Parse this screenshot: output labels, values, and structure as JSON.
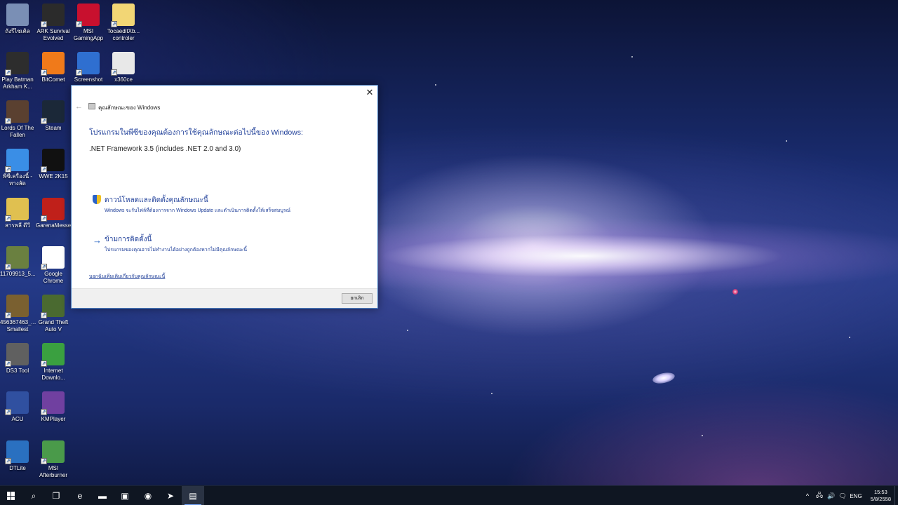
{
  "desktop": {
    "icons": [
      {
        "label": "ถังรีไซเคิล",
        "icon": "recycle-bin-icon"
      },
      {
        "label": "ARK Survival Evolved",
        "icon": "ark-game-icon"
      },
      {
        "label": "MSI GamingApp",
        "icon": "msi-gaming-app-icon"
      },
      {
        "label": "TocaeditXb... controler",
        "icon": "folder-icon"
      },
      {
        "label": "Play Batman Arkham K...",
        "icon": "batman-game-icon"
      },
      {
        "label": "BitComet",
        "icon": "bitcomet-icon"
      },
      {
        "label": "Screenshot",
        "icon": "screenshot-icon"
      },
      {
        "label": "x360ce",
        "icon": "x360ce-icon"
      },
      {
        "label": "Lords Of The Fallen",
        "icon": "lords-of-the-fallen-icon"
      },
      {
        "label": "Steam",
        "icon": "steam-icon"
      },
      {
        "label": "พีซีเครื่องนี้ - ทางลัด",
        "icon": "this-pc-icon"
      },
      {
        "label": "WWE 2K15",
        "icon": "wwe-2k15-icon"
      },
      {
        "label": "สารพลี ดีวี",
        "icon": "shortcut-file-icon"
      },
      {
        "label": "GarenaMesse",
        "icon": "garena-messenger-icon"
      },
      {
        "label": "11709913_5...",
        "icon": "image-file-icon"
      },
      {
        "label": "Google Chrome",
        "icon": "chrome-icon"
      },
      {
        "label": "456367463_... Smallest",
        "icon": "image-file-icon"
      },
      {
        "label": "Grand Theft Auto V",
        "icon": "gta-v-icon"
      },
      {
        "label": "DS3 Tool",
        "icon": "ds3-tool-icon"
      },
      {
        "label": "Internet Downlo...",
        "icon": "internet-download-manager-icon"
      },
      {
        "label": "ACU",
        "icon": "acu-icon"
      },
      {
        "label": "KMPlayer",
        "icon": "kmplayer-icon"
      },
      {
        "label": "DTLite",
        "icon": "dtlite-icon"
      },
      {
        "label": "MSI Afterburner",
        "icon": "msi-afterburner-icon"
      }
    ]
  },
  "dialog": {
    "title": "คุณลักษณะของ Windows",
    "close_glyph": "✕",
    "back_glyph": "←",
    "heading": "โปรแกรมในพีซีของคุณต้องการใช้คุณลักษณะต่อไปนี้ของ Windows:",
    "feature": ".NET Framework 3.5 (includes .NET 2.0 and 3.0)",
    "options": [
      {
        "title": "ดาวน์โหลดและติดตั้งคุณลักษณะนี้",
        "description": "Windows จะรับไฟล์ที่ต้องการจาก Windows Update และดำเนินการติดตั้งให้เสร็จสมบูรณ์",
        "icon": "shield-icon"
      },
      {
        "title": "ข้ามการติดตั้งนี้",
        "description": "โปรแกรมของคุณอาจไม่ทำงานได้อย่างถูกต้องหากไม่มีคุณลักษณะนี้",
        "icon": "arrow-right-icon"
      }
    ],
    "more_info_link": "บอกฉันเพิ่มเติมเกี่ยวกับคุณลักษณะนี้",
    "cancel_label": "ยกเลิก"
  },
  "taskbar": {
    "items": [
      {
        "name": "start-button",
        "icon": "windows-logo-icon"
      },
      {
        "name": "search-button",
        "icon": "search-icon",
        "glyph": "⌕"
      },
      {
        "name": "task-view-button",
        "icon": "task-view-icon",
        "glyph": "❐"
      },
      {
        "name": "edge-button",
        "icon": "edge-icon",
        "glyph": "e"
      },
      {
        "name": "file-explorer-button",
        "icon": "folder-icon",
        "glyph": "▬"
      },
      {
        "name": "store-button",
        "icon": "store-icon",
        "glyph": "▣"
      },
      {
        "name": "chrome-button",
        "icon": "chrome-icon",
        "glyph": "◉"
      },
      {
        "name": "idm-button",
        "icon": "internet-download-manager-icon",
        "glyph": "➤"
      },
      {
        "name": "windows-features-button",
        "icon": "windows-features-icon",
        "glyph": "▤"
      }
    ],
    "tray": {
      "chevron": "^",
      "network": "🖧",
      "volume": "🔊",
      "notifications": "🗨",
      "language": "ENG"
    },
    "clock": {
      "time": "15:53",
      "date": "5/8/2558"
    }
  },
  "colors": {
    "dialog_link": "#1f3f99",
    "taskbar_bg": "#0f1622",
    "accent": "#76a8ff"
  }
}
